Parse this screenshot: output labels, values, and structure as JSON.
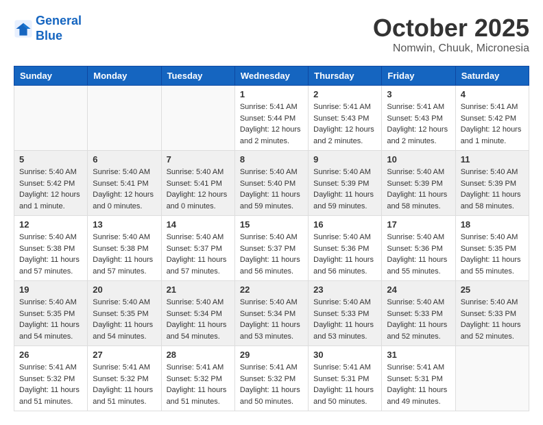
{
  "header": {
    "logo_line1": "General",
    "logo_line2": "Blue",
    "month": "October 2025",
    "location": "Nomwin, Chuuk, Micronesia"
  },
  "weekdays": [
    "Sunday",
    "Monday",
    "Tuesday",
    "Wednesday",
    "Thursday",
    "Friday",
    "Saturday"
  ],
  "weeks": [
    [
      {
        "day": "",
        "sunrise": "",
        "sunset": "",
        "daylight": ""
      },
      {
        "day": "",
        "sunrise": "",
        "sunset": "",
        "daylight": ""
      },
      {
        "day": "",
        "sunrise": "",
        "sunset": "",
        "daylight": ""
      },
      {
        "day": "1",
        "sunrise": "Sunrise: 5:41 AM",
        "sunset": "Sunset: 5:44 PM",
        "daylight": "Daylight: 12 hours and 2 minutes."
      },
      {
        "day": "2",
        "sunrise": "Sunrise: 5:41 AM",
        "sunset": "Sunset: 5:43 PM",
        "daylight": "Daylight: 12 hours and 2 minutes."
      },
      {
        "day": "3",
        "sunrise": "Sunrise: 5:41 AM",
        "sunset": "Sunset: 5:43 PM",
        "daylight": "Daylight: 12 hours and 2 minutes."
      },
      {
        "day": "4",
        "sunrise": "Sunrise: 5:41 AM",
        "sunset": "Sunset: 5:42 PM",
        "daylight": "Daylight: 12 hours and 1 minute."
      }
    ],
    [
      {
        "day": "5",
        "sunrise": "Sunrise: 5:40 AM",
        "sunset": "Sunset: 5:42 PM",
        "daylight": "Daylight: 12 hours and 1 minute."
      },
      {
        "day": "6",
        "sunrise": "Sunrise: 5:40 AM",
        "sunset": "Sunset: 5:41 PM",
        "daylight": "Daylight: 12 hours and 0 minutes."
      },
      {
        "day": "7",
        "sunrise": "Sunrise: 5:40 AM",
        "sunset": "Sunset: 5:41 PM",
        "daylight": "Daylight: 12 hours and 0 minutes."
      },
      {
        "day": "8",
        "sunrise": "Sunrise: 5:40 AM",
        "sunset": "Sunset: 5:40 PM",
        "daylight": "Daylight: 11 hours and 59 minutes."
      },
      {
        "day": "9",
        "sunrise": "Sunrise: 5:40 AM",
        "sunset": "Sunset: 5:39 PM",
        "daylight": "Daylight: 11 hours and 59 minutes."
      },
      {
        "day": "10",
        "sunrise": "Sunrise: 5:40 AM",
        "sunset": "Sunset: 5:39 PM",
        "daylight": "Daylight: 11 hours and 58 minutes."
      },
      {
        "day": "11",
        "sunrise": "Sunrise: 5:40 AM",
        "sunset": "Sunset: 5:39 PM",
        "daylight": "Daylight: 11 hours and 58 minutes."
      }
    ],
    [
      {
        "day": "12",
        "sunrise": "Sunrise: 5:40 AM",
        "sunset": "Sunset: 5:38 PM",
        "daylight": "Daylight: 11 hours and 57 minutes."
      },
      {
        "day": "13",
        "sunrise": "Sunrise: 5:40 AM",
        "sunset": "Sunset: 5:38 PM",
        "daylight": "Daylight: 11 hours and 57 minutes."
      },
      {
        "day": "14",
        "sunrise": "Sunrise: 5:40 AM",
        "sunset": "Sunset: 5:37 PM",
        "daylight": "Daylight: 11 hours and 57 minutes."
      },
      {
        "day": "15",
        "sunrise": "Sunrise: 5:40 AM",
        "sunset": "Sunset: 5:37 PM",
        "daylight": "Daylight: 11 hours and 56 minutes."
      },
      {
        "day": "16",
        "sunrise": "Sunrise: 5:40 AM",
        "sunset": "Sunset: 5:36 PM",
        "daylight": "Daylight: 11 hours and 56 minutes."
      },
      {
        "day": "17",
        "sunrise": "Sunrise: 5:40 AM",
        "sunset": "Sunset: 5:36 PM",
        "daylight": "Daylight: 11 hours and 55 minutes."
      },
      {
        "day": "18",
        "sunrise": "Sunrise: 5:40 AM",
        "sunset": "Sunset: 5:35 PM",
        "daylight": "Daylight: 11 hours and 55 minutes."
      }
    ],
    [
      {
        "day": "19",
        "sunrise": "Sunrise: 5:40 AM",
        "sunset": "Sunset: 5:35 PM",
        "daylight": "Daylight: 11 hours and 54 minutes."
      },
      {
        "day": "20",
        "sunrise": "Sunrise: 5:40 AM",
        "sunset": "Sunset: 5:35 PM",
        "daylight": "Daylight: 11 hours and 54 minutes."
      },
      {
        "day": "21",
        "sunrise": "Sunrise: 5:40 AM",
        "sunset": "Sunset: 5:34 PM",
        "daylight": "Daylight: 11 hours and 54 minutes."
      },
      {
        "day": "22",
        "sunrise": "Sunrise: 5:40 AM",
        "sunset": "Sunset: 5:34 PM",
        "daylight": "Daylight: 11 hours and 53 minutes."
      },
      {
        "day": "23",
        "sunrise": "Sunrise: 5:40 AM",
        "sunset": "Sunset: 5:33 PM",
        "daylight": "Daylight: 11 hours and 53 minutes."
      },
      {
        "day": "24",
        "sunrise": "Sunrise: 5:40 AM",
        "sunset": "Sunset: 5:33 PM",
        "daylight": "Daylight: 11 hours and 52 minutes."
      },
      {
        "day": "25",
        "sunrise": "Sunrise: 5:40 AM",
        "sunset": "Sunset: 5:33 PM",
        "daylight": "Daylight: 11 hours and 52 minutes."
      }
    ],
    [
      {
        "day": "26",
        "sunrise": "Sunrise: 5:41 AM",
        "sunset": "Sunset: 5:32 PM",
        "daylight": "Daylight: 11 hours and 51 minutes."
      },
      {
        "day": "27",
        "sunrise": "Sunrise: 5:41 AM",
        "sunset": "Sunset: 5:32 PM",
        "daylight": "Daylight: 11 hours and 51 minutes."
      },
      {
        "day": "28",
        "sunrise": "Sunrise: 5:41 AM",
        "sunset": "Sunset: 5:32 PM",
        "daylight": "Daylight: 11 hours and 51 minutes."
      },
      {
        "day": "29",
        "sunrise": "Sunrise: 5:41 AM",
        "sunset": "Sunset: 5:32 PM",
        "daylight": "Daylight: 11 hours and 50 minutes."
      },
      {
        "day": "30",
        "sunrise": "Sunrise: 5:41 AM",
        "sunset": "Sunset: 5:31 PM",
        "daylight": "Daylight: 11 hours and 50 minutes."
      },
      {
        "day": "31",
        "sunrise": "Sunrise: 5:41 AM",
        "sunset": "Sunset: 5:31 PM",
        "daylight": "Daylight: 11 hours and 49 minutes."
      },
      {
        "day": "",
        "sunrise": "",
        "sunset": "",
        "daylight": ""
      }
    ]
  ]
}
